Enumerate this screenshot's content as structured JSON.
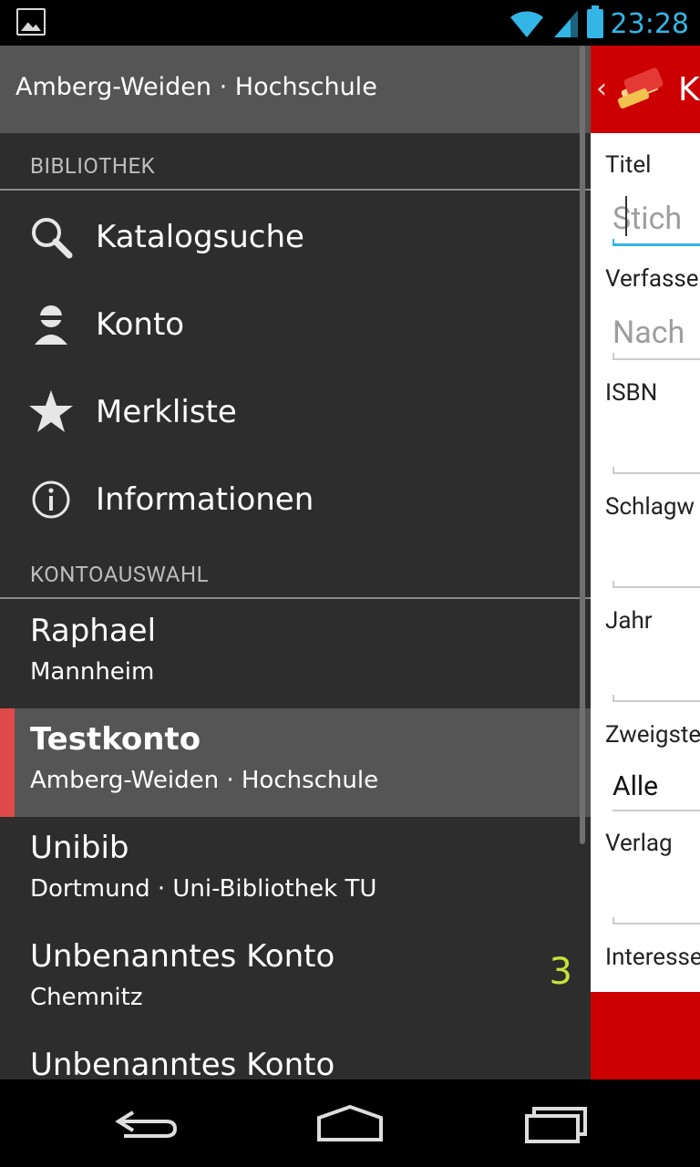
{
  "status_bar": {
    "time": "23:28",
    "accent": "#33b5e5"
  },
  "drawer": {
    "header_title": "Amberg-Weiden · Hochschule",
    "section_library": "BIBLIOTHEK",
    "nav_items": [
      {
        "label": "Katalogsuche",
        "icon": "search-icon"
      },
      {
        "label": "Konto",
        "icon": "account-icon"
      },
      {
        "label": "Merkliste",
        "icon": "star-icon"
      },
      {
        "label": "Informationen",
        "icon": "info-icon"
      }
    ],
    "section_accounts": "KONTOAUSWAHL",
    "accounts": [
      {
        "name": "Raphael",
        "library": "Mannheim",
        "selected": false
      },
      {
        "name": "Testkonto",
        "library": "Amberg-Weiden · Hochschule",
        "selected": true
      },
      {
        "name": "Unibib",
        "library": "Dortmund · Uni-Bibliothek TU",
        "selected": false
      },
      {
        "name": "Unbenanntes Konto",
        "library": "Chemnitz",
        "badge": "3",
        "selected": false
      },
      {
        "name": "Unbenanntes Konto",
        "library": "",
        "selected": false
      }
    ],
    "selected_color": "#e04a4a"
  },
  "content": {
    "app_title": "K",
    "brand_color": "#cc0000",
    "fields": [
      {
        "label": "Titel",
        "placeholder": "Stich"
      },
      {
        "label": "Verfasse",
        "placeholder": "Nach"
      },
      {
        "label": "ISBN",
        "placeholder": ""
      },
      {
        "label": "Schlagw",
        "placeholder": ""
      },
      {
        "label": "Jahr",
        "placeholder": ""
      },
      {
        "label": "Zweigste",
        "value": "Alle"
      },
      {
        "label": "Verlag",
        "placeholder": ""
      },
      {
        "label": "Interesse",
        "placeholder": ""
      }
    ]
  },
  "navbar": {
    "buttons": [
      "back-icon",
      "home-icon",
      "recent-apps-icon"
    ]
  }
}
